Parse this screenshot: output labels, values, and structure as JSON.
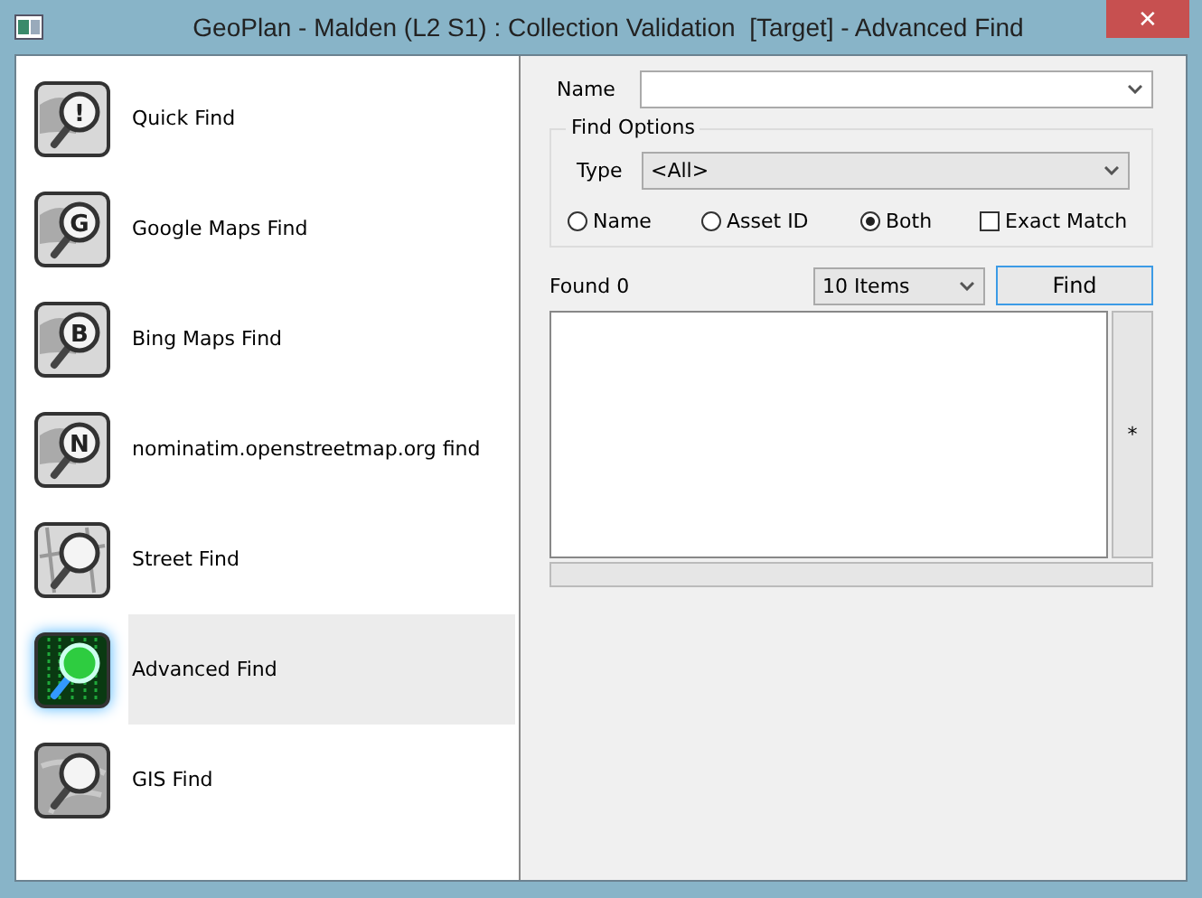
{
  "window": {
    "title": "GeoPlan - Malden (L2 S1) : Collection Validation  [Target] - Advanced Find",
    "close": "✕"
  },
  "sidebar": {
    "items": [
      {
        "label": "Quick Find",
        "kind": "letter",
        "badge": "!",
        "selected": false
      },
      {
        "label": "Google Maps Find",
        "kind": "letter",
        "badge": "G",
        "selected": false
      },
      {
        "label": "Bing Maps Find",
        "kind": "letter",
        "badge": "B",
        "selected": false
      },
      {
        "label": "nominatim.openstreetmap.org find",
        "kind": "letter",
        "badge": "N",
        "selected": false
      },
      {
        "label": "Street Find",
        "kind": "street",
        "selected": false
      },
      {
        "label": "Advanced Find",
        "kind": "matrix",
        "selected": true
      },
      {
        "label": "GIS Find",
        "kind": "gis",
        "selected": false
      }
    ]
  },
  "form": {
    "name_label": "Name",
    "find_options": {
      "title": "Find Options",
      "type_label": "Type",
      "type_value": "<All>",
      "radios": [
        {
          "label": "Name",
          "selected": false
        },
        {
          "label": "Asset ID",
          "selected": false
        },
        {
          "label": "Both",
          "selected": true
        }
      ],
      "exact_match": {
        "label": "Exact Match",
        "checked": false
      }
    },
    "found": "Found 0",
    "items_value": "10 Items",
    "find_button": "Find",
    "side_button": "*"
  }
}
